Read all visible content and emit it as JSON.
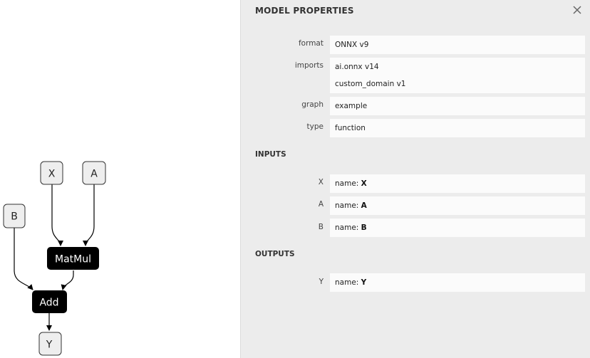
{
  "graph": {
    "nodes": {
      "x": "X",
      "a": "A",
      "b": "B",
      "matmul": "MatMul",
      "add": "Add",
      "y": "Y"
    }
  },
  "sidebar": {
    "title": "MODEL PROPERTIES",
    "close_icon": "close-icon",
    "model": {
      "format_label": "format",
      "format_value": "ONNX v9",
      "imports_label": "imports",
      "imports_values": [
        "ai.onnx v14",
        "custom_domain v1"
      ],
      "graph_label": "graph",
      "graph_value": "example",
      "type_label": "type",
      "type_value": "function"
    },
    "inputs_header": "INPUTS",
    "inputs": [
      {
        "label": "X",
        "name_prefix": "name: ",
        "name": "X"
      },
      {
        "label": "A",
        "name_prefix": "name: ",
        "name": "A"
      },
      {
        "label": "B",
        "name_prefix": "name: ",
        "name": "B"
      }
    ],
    "outputs_header": "OUTPUTS",
    "outputs": [
      {
        "label": "Y",
        "name_prefix": "name: ",
        "name": "Y"
      }
    ]
  },
  "colors": {
    "node_dark": "#000000",
    "node_light": "#eeeeee",
    "sidebar_bg": "#ececec"
  }
}
